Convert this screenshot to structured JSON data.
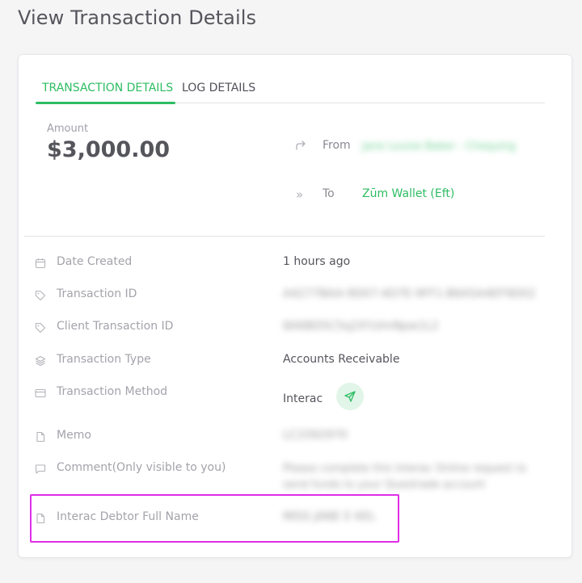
{
  "page": {
    "title": "View Transaction Details"
  },
  "tabs": [
    {
      "label": "TRANSACTION DETAILS",
      "active": true
    },
    {
      "label": "LOG DETAILS",
      "active": false
    }
  ],
  "summary": {
    "amount_label": "Amount",
    "amount_value": "$3,000.00",
    "from_label": "From",
    "from_value": "Jane Louise Baker - Chequing",
    "to_label": "To",
    "to_value": "Zūm Wallet (Eft)"
  },
  "details": [
    {
      "icon": "calendar-icon",
      "label": "Date Created",
      "value": "1 hours ago",
      "blurred": false
    },
    {
      "icon": "tag-icon",
      "label": "Transaction ID",
      "value": "A4277BAA-9D07-4D7E-9FF1-B6A5A4EF9D02",
      "blurred": true
    },
    {
      "icon": "tag-icon",
      "label": "Client Transaction ID",
      "value": "8A6BD5C5q2XYzlmNpw1L2",
      "blurred": true
    },
    {
      "icon": "layers-icon",
      "label": "Transaction Type",
      "value": "Accounts Receivable",
      "blurred": false
    },
    {
      "icon": "credit-card-icon",
      "label": "Transaction Method",
      "value": "Interac",
      "blurred": false
    },
    {
      "icon": "file-icon",
      "label": "Memo",
      "value": "LC3392970",
      "blurred": true
    },
    {
      "icon": "comment-icon",
      "label": "Comment(Only visible to you)",
      "value": "Please complete this Interac Online request to send funds to your Questrade account",
      "blurred": true
    },
    {
      "icon": "file-icon",
      "label": "Interac Debtor Full Name",
      "value": "MISS JANE E KEL",
      "blurred": true
    }
  ],
  "colors": {
    "accent": "#2dbd62",
    "highlight": "#e02de8"
  }
}
